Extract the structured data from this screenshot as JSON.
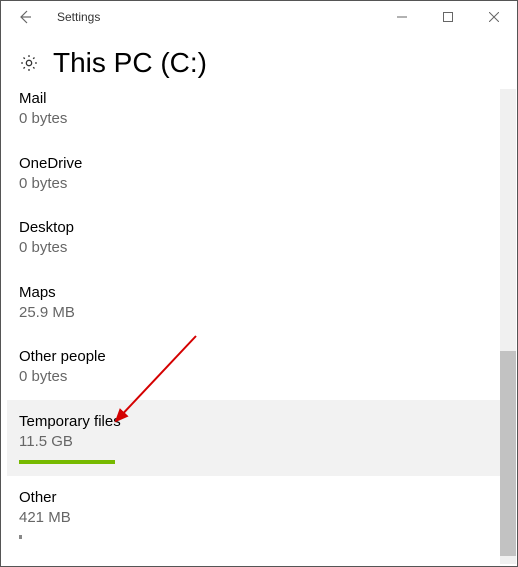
{
  "window": {
    "title": "Settings"
  },
  "page": {
    "title": "This PC (C:)"
  },
  "storage": {
    "items": [
      {
        "name": "Mail",
        "size": "0 bytes",
        "partial_top": true
      },
      {
        "name": "OneDrive",
        "size": "0 bytes"
      },
      {
        "name": "Desktop",
        "size": "0 bytes"
      },
      {
        "name": "Maps",
        "size": "25.9 MB"
      },
      {
        "name": "Other people",
        "size": "0 bytes"
      },
      {
        "name": "Temporary files",
        "size": "11.5 GB",
        "selected": true,
        "meter_pct": 20
      },
      {
        "name": "Other",
        "size": "421 MB",
        "tiny_meter": true
      }
    ]
  },
  "annotation": {
    "arrow_color": "#d40000"
  }
}
